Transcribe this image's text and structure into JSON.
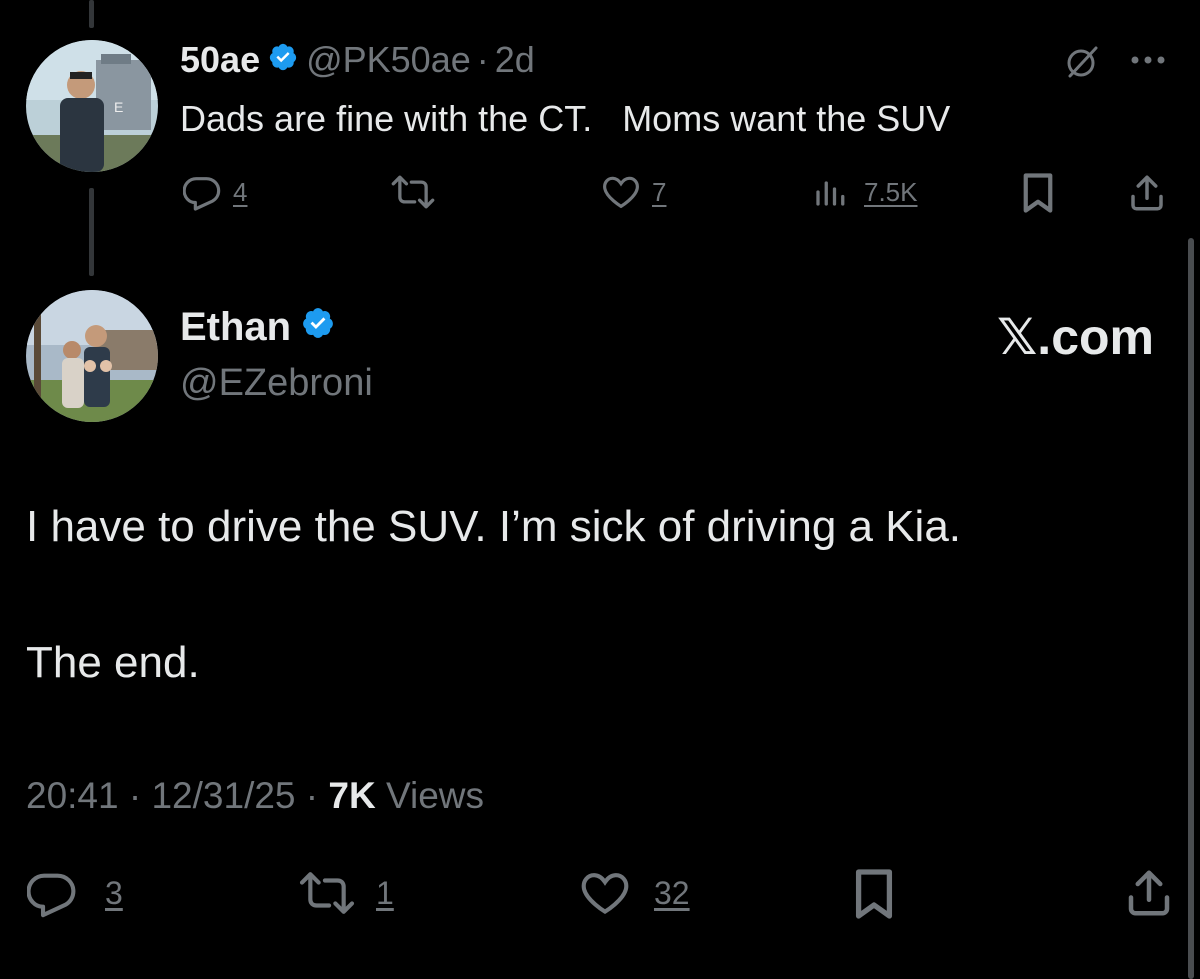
{
  "reply_to": {
    "display_name": "50ae",
    "handle": "@PK50ae",
    "separator": "·",
    "age": "2d",
    "text": "Dads are fine with the CT.   Moms want the SUV",
    "actions": {
      "replies": "4",
      "likes": "7",
      "views": "7.5K"
    }
  },
  "main_post": {
    "display_name": "Ethan",
    "handle": "@EZebroni",
    "brand": "𝕏.com",
    "text_line1": "I have to drive the SUV. I’m sick of driving a Kia.",
    "text_line2": "The end.",
    "meta": {
      "time": "20:41",
      "sep1": "·",
      "date": "12/31/25",
      "sep2": "·",
      "views_count": "7K",
      "views_label": "Views"
    },
    "actions": {
      "replies": "3",
      "reposts": "1",
      "likes": "32"
    }
  },
  "colors": {
    "background": "#000000",
    "text": "#e7e9ea",
    "muted": "#71767b",
    "verified": "#1d9bf0"
  },
  "icons": [
    "reply-icon",
    "repost-icon",
    "like-icon",
    "views-icon",
    "bookmark-icon",
    "share-icon",
    "grok-icon",
    "more-icon",
    "verified-badge-icon"
  ]
}
